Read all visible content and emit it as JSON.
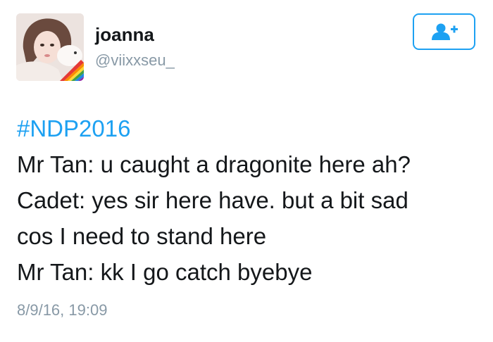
{
  "author": {
    "display_name": "joanna",
    "handle": "@viixxseu_"
  },
  "follow_button": {
    "icon": "add-user-icon",
    "color": "#1da1f2"
  },
  "tweet": {
    "hashtag": "#NDP2016",
    "lines": [
      "Mr Tan: u caught a dragonite here ah?",
      "Cadet: yes sir here have. but a bit sad",
      "cos I need to stand here",
      "Mr Tan: kk I go catch byebye"
    ],
    "timestamp": "8/9/16, 19:09"
  },
  "colors": {
    "accent": "#1da1f2",
    "text": "#14171a",
    "secondary": "#8899a6"
  }
}
